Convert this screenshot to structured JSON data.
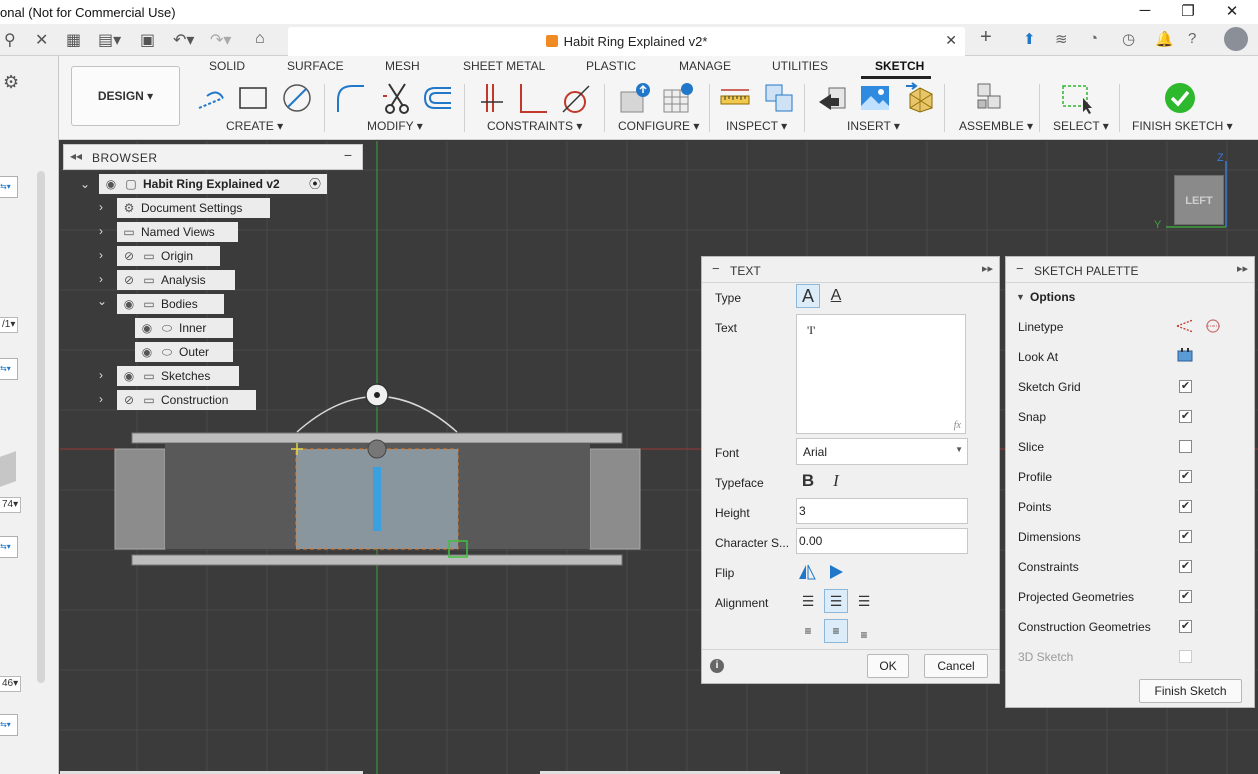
{
  "window": {
    "title": "onal (Not for Commercial Use)",
    "minimize": "─",
    "restore": "❐",
    "close": "✕"
  },
  "tabbar": {
    "doc_title": "Habit Ring Explained v2*",
    "close": "✕",
    "add": "+"
  },
  "ribbon": {
    "tabs": [
      "SOLID",
      "SURFACE",
      "MESH",
      "SHEET METAL",
      "PLASTIC",
      "MANAGE",
      "UTILITIES",
      "SKETCH"
    ],
    "active_tab": "SKETCH",
    "design_label": "DESIGN ▾",
    "groups": {
      "create": "CREATE ▾",
      "modify": "MODIFY ▾",
      "constraints": "CONSTRAINTS ▾",
      "configure": "CONFIGURE ▾",
      "inspect": "INSPECT ▾",
      "insert": "INSERT ▾",
      "assemble": "ASSEMBLE ▾",
      "select": "SELECT ▾",
      "finish": "FINISH SKETCH ▾"
    }
  },
  "left_strip": {
    "chips": [
      "⇆▾",
      "/1▾",
      "⇆▾",
      "74▾",
      "⇆▾",
      "46▾",
      "⇆▾"
    ]
  },
  "browser": {
    "title": "BROWSER",
    "items": {
      "root": "Habit Ring Explained v2",
      "document_settings": "Document Settings",
      "named_views": "Named Views",
      "origin": "Origin",
      "analysis": "Analysis",
      "bodies": "Bodies",
      "inner": "Inner",
      "outer": "Outer",
      "sketches": "Sketches",
      "construction": "Construction"
    }
  },
  "text_dialog": {
    "title": "TEXT",
    "type_label": "Type",
    "text_label": "Text",
    "text_value": "'I'",
    "fx": "fx",
    "font_label": "Font",
    "font_value": "Arial",
    "typeface_label": "Typeface",
    "height_label": "Height",
    "height_value": "3",
    "charspacing_label": "Character S...",
    "charspacing_value": "0.00",
    "flip_label": "Flip",
    "alignment_label": "Alignment",
    "ok": "OK",
    "cancel": "Cancel",
    "bold_glyph": "B",
    "italic_glyph": "I"
  },
  "palette": {
    "title": "SKETCH PALETTE",
    "options_label": "Options",
    "rows": [
      {
        "label": "Linetype",
        "kind": "icons"
      },
      {
        "label": "Look At",
        "kind": "icon"
      },
      {
        "label": "Sketch Grid",
        "checked": true
      },
      {
        "label": "Snap",
        "checked": true
      },
      {
        "label": "Slice",
        "checked": false
      },
      {
        "label": "Profile",
        "checked": true
      },
      {
        "label": "Points",
        "checked": true
      },
      {
        "label": "Dimensions",
        "checked": true
      },
      {
        "label": "Constraints",
        "checked": true
      },
      {
        "label": "Projected Geometries",
        "checked": true
      },
      {
        "label": "Construction Geometries",
        "checked": true
      },
      {
        "label": "3D Sketch",
        "checked": false,
        "disabled": true
      }
    ],
    "finish_button": "Finish Sketch",
    "check_glyph": "✔"
  },
  "viewcube": {
    "face_label": "LEFT",
    "axis_y": "Y",
    "axis_z": "Z"
  },
  "colors": {
    "accent_blue": "#2278c8",
    "finish_green": "#2eb82e",
    "ribbon_bg": "#f5f5f5",
    "canvas_bg": "#3b3b3b"
  }
}
